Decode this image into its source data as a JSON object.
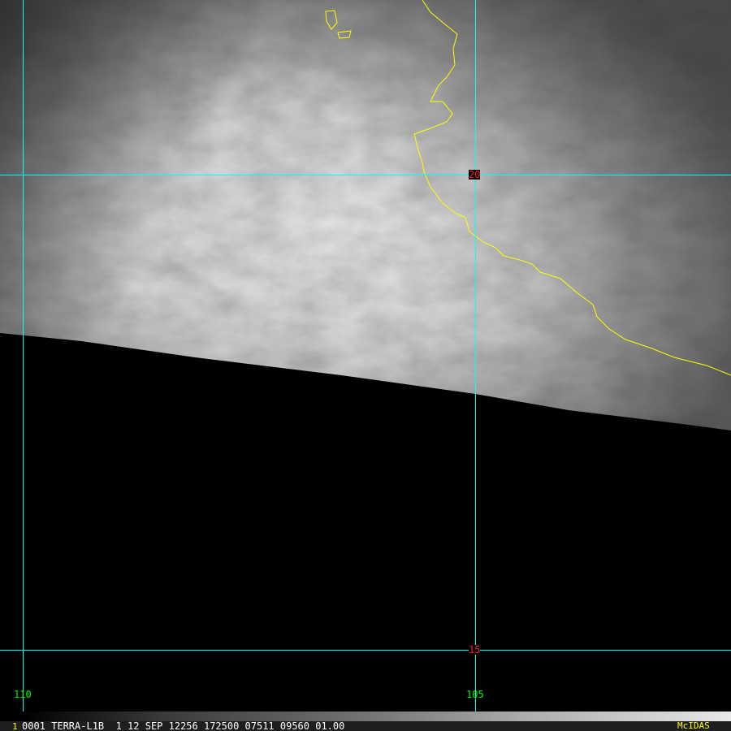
{
  "grid": {
    "lat_labels": [
      "20",
      "15"
    ],
    "lon_labels": [
      "110",
      "105"
    ],
    "lat_color": "#ff2020",
    "lon_color": "#00ff00",
    "line_color": "#00ffff"
  },
  "coastline_color": "#ffff00",
  "status": {
    "frame_index": "1",
    "info": "0001 TERRA-L1B  1 12 SEP 12256 172500 07511 09560 01.00",
    "brand": "McIDAS"
  }
}
